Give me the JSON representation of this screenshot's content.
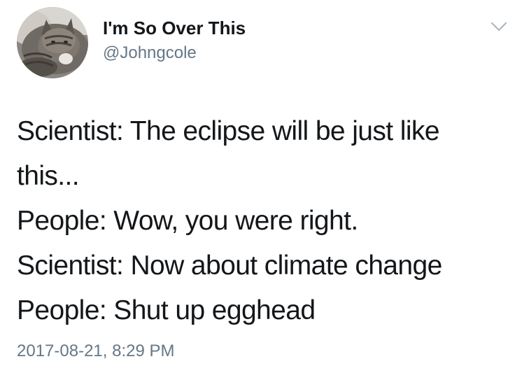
{
  "author": {
    "display_name": "I'm So Over This",
    "handle": "@Johngcole",
    "avatar_icon": "cat-avatar-icon"
  },
  "menu_icon": "chevron-down-icon",
  "tweet": {
    "lines": [
      "Scientist:  The eclipse will be just like",
      "this...",
      "People: Wow, you were right.",
      "Scientist: Now about climate change",
      "People: Shut up egghead"
    ],
    "timestamp": "2017-08-21, 8:29 PM"
  },
  "colors": {
    "primary_text": "#14171a",
    "secondary_text": "#657786",
    "chevron": "#aab8c2",
    "background": "#ffffff"
  }
}
